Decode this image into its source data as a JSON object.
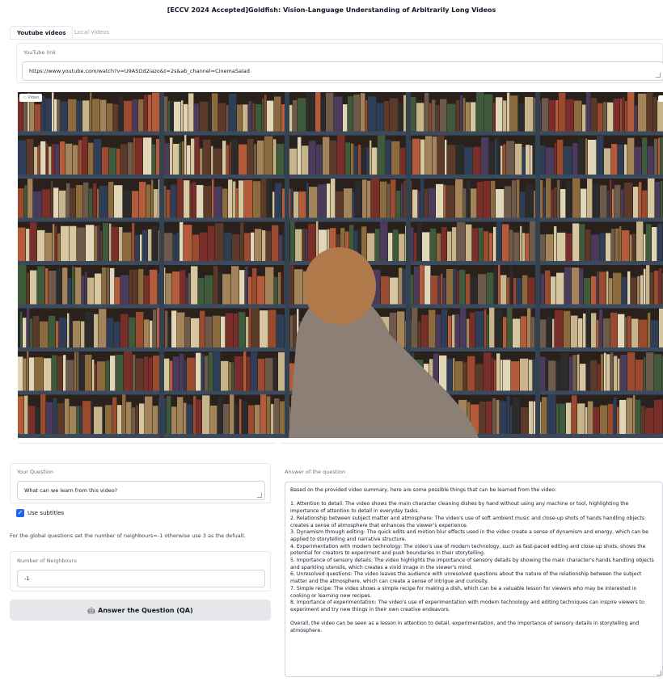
{
  "title": "[ECCV 2024 Accepted]Goldfish: Vision-Language Understanding of Arbitrarily Long Videos",
  "tabs": [
    {
      "label": "Youtube videos",
      "active": true
    },
    {
      "label": "Local videos",
      "active": false
    }
  ],
  "youtube": {
    "label": "YouTube link",
    "value": "https://www.youtube.com/watch?v=U9ASOd2iazo&t=2s&ab_channel=CinemaSalad"
  },
  "video": {
    "label": "Video"
  },
  "question": {
    "label": "Your Question",
    "value": "What can we learn from this video?"
  },
  "subtitles": {
    "label": "Use subtitles",
    "checked": true
  },
  "note": "For the global questions set the number of neighbours=-1 otherwise use 3 as the defualt.",
  "neighbours": {
    "label": "Number of Neighbours",
    "value": "-1"
  },
  "answer_button": {
    "icon": "robot-icon",
    "label": "Answer the Question (QA)"
  },
  "answer": {
    "label": "Answer of the question",
    "text": "Based on the provided video summary, here are some possible things that can be learned from the video:\n\n1. Attention to detail: The video shows the main character cleaning dishes by hand without using any machine or tool, highlighting the importance of attention to detail in everyday tasks.\n2. Relationship between subject matter and atmosphere: The video's use of soft ambient music and close-up shots of hands handling objects creates a sense of atmosphere that enhances the viewer's experience.\n3. Dynamism through editing: The quick edits and motion blur effects used in the video create a sense of dynamism and energy, which can be applied to storytelling and narrative structure.\n4. Experimentation with modern technology: The video's use of modern technology, such as fast-paced editing and close-up shots, shows the potential for creators to experiment and push boundaries in their storytelling.\n5. Importance of sensory details: The video highlights the importance of sensory details by showing the main character's hands handling objects and sparkling utensils, which creates a vivid image in the viewer's mind.\n6. Unresolved questions: The video leaves the audience with unresolved questions about the nature of the relationship between the subject matter and the atmosphere, which can create a sense of intrigue and curiosity.\n7. Simple recipe: The video shows a simple recipe for making a dish, which can be a valuable lesson for viewers who may be interested in cooking or learning new recipes.\n8. Importance of experimentation: The video's use of experimentation with modern technology and editing techniques can inspire viewers to experiment and try new things in their own creative endeavors.\n\nOverall, the video can be seen as a lesson in attention to detail, experimentation, and the importance of sensory details in storytelling and atmosphere."
  },
  "colors": {
    "accent": "#2563eb",
    "button_bg": "#e5e7eb",
    "border": "#e5e7eb"
  }
}
